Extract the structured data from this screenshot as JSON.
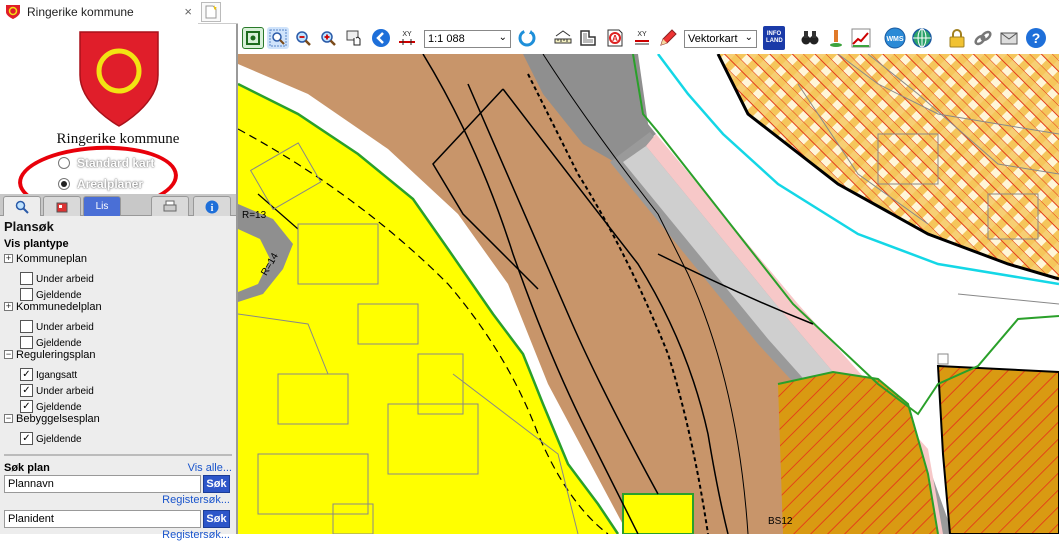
{
  "browser": {
    "tab_title": "Ringerike kommune",
    "close": "×"
  },
  "header": {
    "municipality": "Ringerike kommune",
    "map_types": [
      {
        "label": "Standard kart",
        "selected": false
      },
      {
        "label": "Arealplaner",
        "selected": true
      }
    ]
  },
  "panel_tabs": [
    "search",
    "layers",
    "lister",
    "print",
    "info"
  ],
  "panel_tab_partial_label": "Lis",
  "plansok": {
    "title": "Plansøk",
    "vis_plantype": "Vis plantype",
    "groups": [
      {
        "label": "Kommuneplan",
        "toggle": "+",
        "options": [
          {
            "label": "Under arbeid",
            "checked": false
          },
          {
            "label": "Gjeldende",
            "checked": false
          }
        ]
      },
      {
        "label": "Kommunedelplan",
        "toggle": "+",
        "options": [
          {
            "label": "Under arbeid",
            "checked": false
          },
          {
            "label": "Gjeldende",
            "checked": false
          }
        ]
      },
      {
        "label": "Reguleringsplan",
        "toggle": "−",
        "options": [
          {
            "label": "Igangsatt",
            "checked": true
          },
          {
            "label": "Under arbeid",
            "checked": true
          },
          {
            "label": "Gjeldende",
            "checked": true
          }
        ]
      },
      {
        "label": "Bebyggelsesplan",
        "toggle": "−",
        "options": [
          {
            "label": "Gjeldende",
            "checked": true
          }
        ]
      }
    ]
  },
  "search": {
    "title": "Søk plan",
    "vis_alle": "Vis alle...",
    "plannavn_value": "Plannavn",
    "planident_value": "Planident",
    "sok_label": "Søk",
    "registersok_label": "Registersøk..."
  },
  "toolbar": {
    "scale": "1:1 088",
    "map_style": "Vektorkart",
    "wms_label": "WMS",
    "infoland_label": "INFO LAND",
    "xy_label": "XY"
  },
  "map": {
    "labels": [
      "R=13",
      "R=14",
      "BS12"
    ],
    "colors": {
      "residential": "#ffff00",
      "road_area": "#c8956a",
      "rail_grey": "#8f8f8f",
      "pink": "#f7c8c8",
      "hatch_orange": "#d99a12",
      "hatch_yellow": "#f5c65b",
      "cyan_line": "#14d7e6",
      "green_border": "#2aa02a"
    }
  },
  "colors": {
    "crest_red": "#e01e2a",
    "crest_gold": "#f2e313",
    "annotation_red": "#e8000a",
    "link_blue": "#1a55cc",
    "button_blue": "#2d56c9"
  }
}
